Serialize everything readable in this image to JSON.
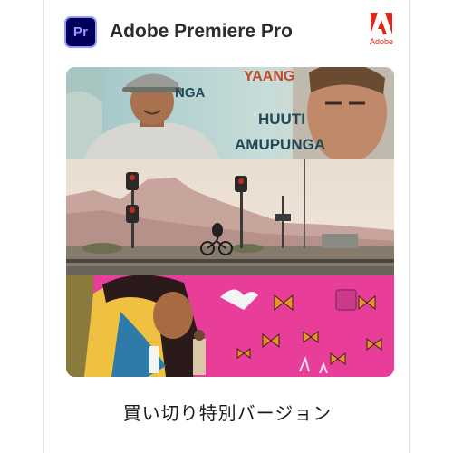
{
  "product": {
    "name": "Adobe Premiere Pro",
    "app_icon_text": "Pr",
    "app_icon": "premiere-pro-icon",
    "brand_logo": "adobe-logo",
    "brand_wordmark": "Adobe"
  },
  "hero": {
    "panel_1": {
      "mural_words": [
        "YAANG",
        "NGA",
        "HUUTI",
        "AMUPUNGA"
      ]
    },
    "panel_2": {},
    "panel_3": {}
  },
  "edition_label": "買い切り特別バージョン",
  "colors": {
    "app_icon_bg": "#00005b",
    "app_icon_fg": "#9999ff",
    "adobe_red": "#e1251b",
    "mural_pink": "#e83e9a"
  }
}
